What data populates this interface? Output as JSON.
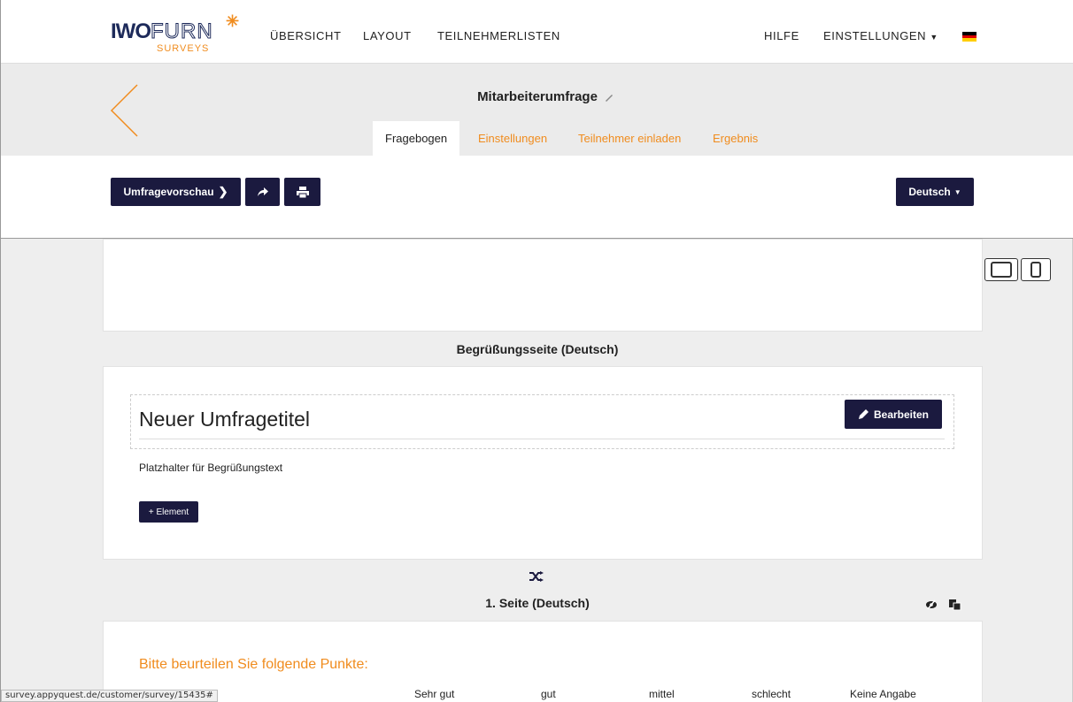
{
  "nav": {
    "logo_main": "IWO",
    "logo_outline": "FURN",
    "logo_sub": "SURVEYS",
    "overview": "ÜBERSICHT",
    "layout": "LAYOUT",
    "participant_lists": "TEILNEHMERLISTEN",
    "help": "HILFE",
    "settings": "EINSTELLUNGEN",
    "flag_colors": [
      "#000000",
      "#dd0000",
      "#ffce00"
    ]
  },
  "header": {
    "survey_title": "Mitarbeiterumfrage",
    "tabs": [
      {
        "label": "Fragebogen",
        "active": true
      },
      {
        "label": "Einstellungen",
        "active": false
      },
      {
        "label": "Teilnehmer einladen",
        "active": false
      },
      {
        "label": "Ergebnis",
        "active": false
      }
    ]
  },
  "toolbar": {
    "preview_label": "Umfragevorschau",
    "language_label": "Deutsch"
  },
  "devices": [
    "desktop-icon",
    "tablet-icon",
    "phone-icon"
  ],
  "welcome": {
    "section_label": "Begrüßungsseite (Deutsch)",
    "title": "Neuer Umfragetitel",
    "edit_label": "Bearbeiten",
    "placeholder_text": "Platzhalter für Begrüßungstext",
    "add_element_label": "+ Element"
  },
  "page1": {
    "section_label": "1. Seite (Deutsch)",
    "question": "Bitte beurteilen Sie folgende Punkte:",
    "columns": [
      "Sehr gut",
      "gut",
      "mittel",
      "schlecht",
      "Keine Angabe"
    ]
  },
  "status_url": "survey.appyquest.de/customer/survey/15435#",
  "colors": {
    "accent": "#f08c1e",
    "button": "#1b1a3f"
  }
}
